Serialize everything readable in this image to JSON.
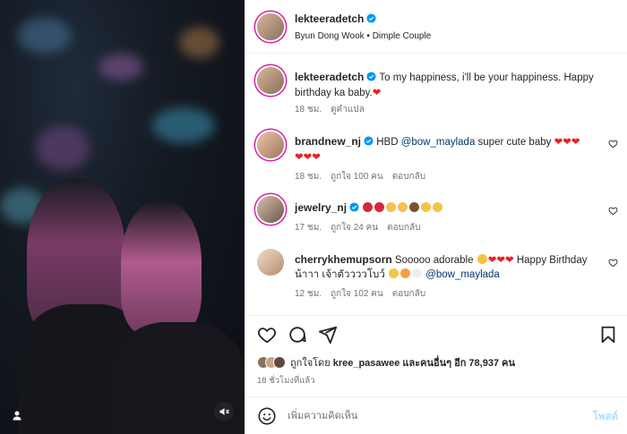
{
  "post": {
    "author": "lekteeradetch",
    "subtitle": "Byun Dong Wook • Dimple Couple",
    "caption": "To my happiness, i'll be your happiness. Happy birthday ka baby.",
    "caption_time": "18 ชม.",
    "see_translation": "ดูคำแปล"
  },
  "comments": [
    {
      "user": "brandnew_nj",
      "text_prefix": "HBD ",
      "mention": "@bow_maylada",
      "text_suffix": " super cute baby",
      "time": "18 ชม.",
      "likes": "ถูกใจ 100 คน",
      "reply": "ตอบกลับ"
    },
    {
      "user": "jewelry_nj",
      "time": "17 ชม.",
      "likes": "ถูกใจ 24 คน",
      "reply": "ตอบกลับ"
    },
    {
      "user": "cherrykhemupsorn",
      "text_prefix": "Sooooo adorable ",
      "text_mid": " Happy Birthday น้าาา เจ้าตัววววโบว์ ",
      "mention": "@bow_maylada",
      "time": "12 ชม.",
      "likes": "ถูกใจ 102 คน",
      "reply": "ตอบกลับ"
    }
  ],
  "likes_line": {
    "prefix": "ถูกใจโดย ",
    "user": "kree_pasawee",
    "suffix": " และคนอื่นๆ อีก 78,937 คน"
  },
  "post_time": "18 ชั่วโมงที่แล้ว",
  "comment_input": {
    "placeholder": "เพิ่มความคิดเห็น"
  },
  "post_button": "โพสต์",
  "icons": [
    "verified-icon",
    "heart-icon",
    "comment-icon",
    "share-icon",
    "bookmark-icon",
    "emoji-icon",
    "user-tag-icon",
    "mute-icon"
  ],
  "colors": {
    "verified": "#0095f6",
    "heart_red": "#ed1c24",
    "mention": "#00376b",
    "post_button": "#b2dffc"
  }
}
